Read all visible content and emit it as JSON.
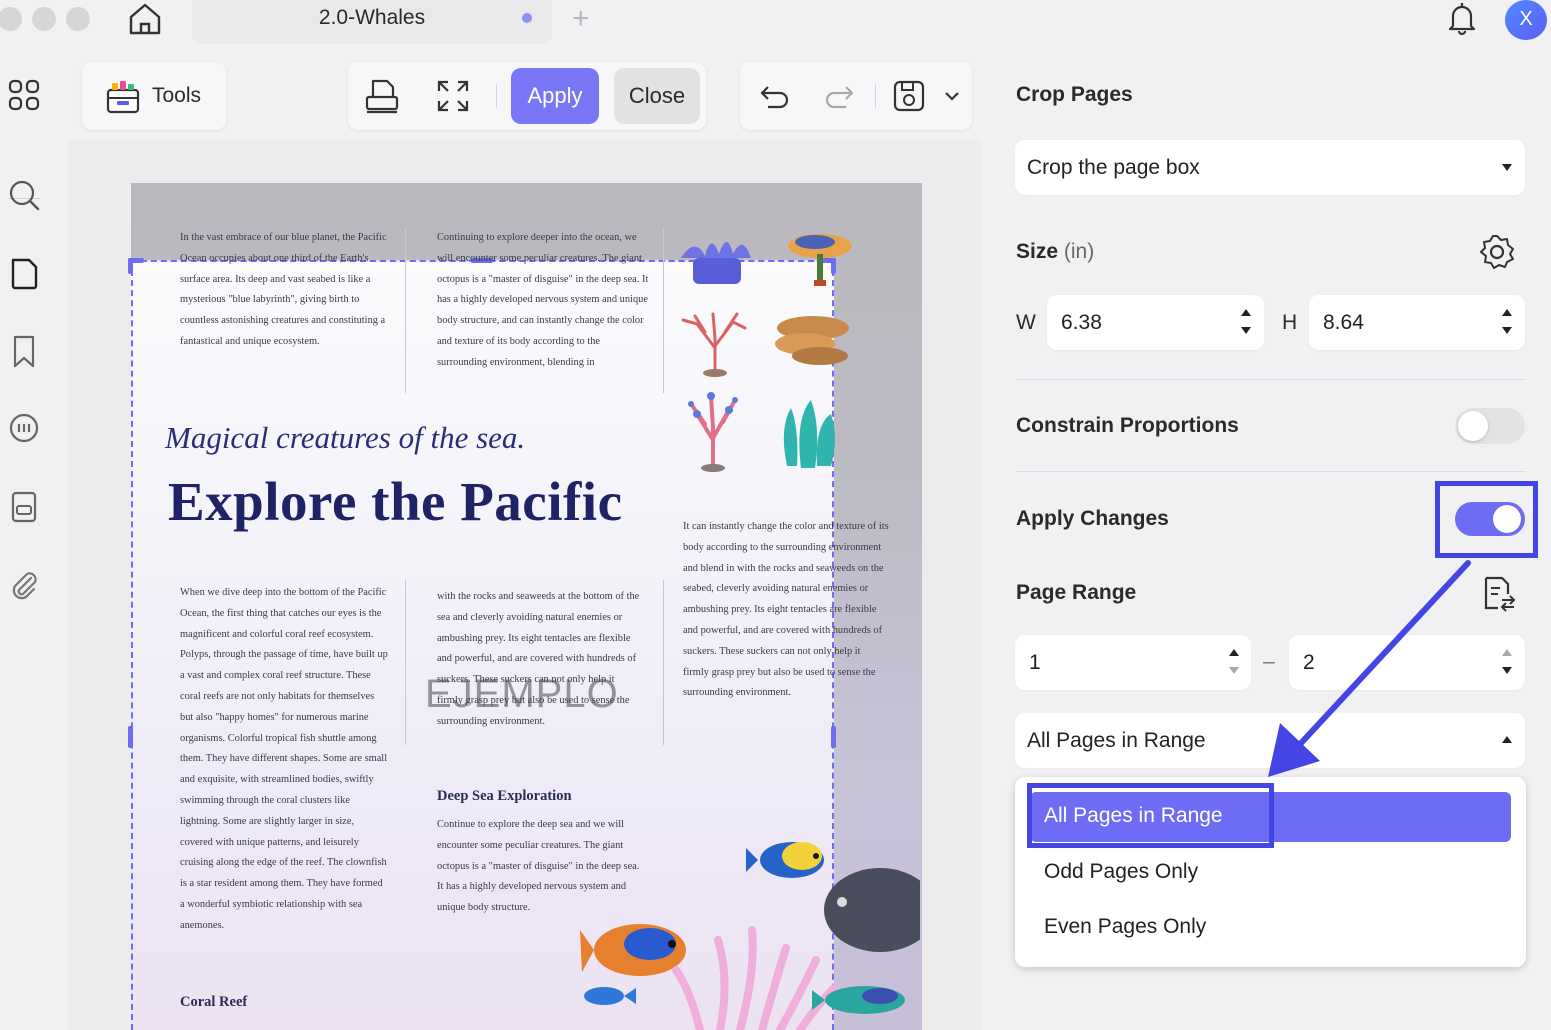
{
  "window": {
    "tab_title": "2.0-Whales",
    "avatar_letter": "X"
  },
  "toolbar": {
    "tools_label": "Tools",
    "apply_label": "Apply",
    "close_label": "Close"
  },
  "document": {
    "col1_top": "In the vast embrace of our blue planet, the Pacific Ocean occupies about one third of the Earth's surface area. Its deep and vast seabed is like a mysterious \"blue labyrinth\", giving birth to countless astonishing creatures and constituting a fantastical and unique ecosystem.",
    "col2_top": "Continuing to explore deeper into the ocean, we will encounter some peculiar creatures. The giant octopus is a \"master of disguise\" in the deep sea. It has a highly developed nervous system and unique body structure, and can instantly change the color and texture of its body according to the surrounding environment, blending in",
    "subtitle": "Magical creatures of the sea.",
    "title": "Explore the Pacific",
    "col3_right": "It can instantly change the color and texture of its body according to the surrounding environment and blend in with the rocks and seaweeds on the seabed, cleverly avoiding natural enemies or ambushing prey. Its eight tentacles are flexible and powerful, and are covered with hundreds of suckers. These suckers can not only help it firmly grasp prey but also be used to sense the surrounding environment.",
    "col1_bottom": "When we dive deep into the bottom of the Pacific Ocean, the first thing that catches our eyes is the magnificent and colorful coral reef ecosystem. Polyps, through the passage of time, have built up a vast and complex coral reef structure. These coral reefs are not only habitats for themselves but also \"happy homes\" for numerous marine organisms. Colorful tropical fish shuttle among them. They have different shapes. Some are small and exquisite, with streamlined bodies, swiftly swimming through the coral clusters like lightning. Some are slightly larger in size, covered with unique patterns, and leisurely cruising along the edge of the reef. The clownfish is a star resident among them. They have formed a wonderful symbiotic relationship with sea anemones.",
    "col2_mid": "with the rocks and seaweeds at the bottom of the sea and cleverly avoiding natural enemies or ambushing prey. Its eight tentacles are flexible and powerful, and are covered with hundreds of suckers. These suckers can not only help it firmly grasp prey but also be used to sense the surrounding environment.",
    "deep_sea_heading": "Deep Sea Exploration",
    "deep_sea_text": "Continue to explore the deep sea and we will encounter some peculiar creatures. The giant octopus is a \"master of disguise\" in the deep sea. It has a highly developed nervous system and unique body structure.",
    "coral_reef_heading": "Coral Reef",
    "watermark": "EJEMPLO"
  },
  "panel": {
    "title": "Crop Pages",
    "crop_mode": "Crop the page box",
    "size_label": "Size",
    "size_unit": "(in)",
    "w_label": "W",
    "w_value": "6.38",
    "h_label": "H",
    "h_value": "8.64",
    "constrain_label": "Constrain Proportions",
    "constrain_on": false,
    "apply_changes_label": "Apply Changes",
    "apply_changes_on": true,
    "page_range_label": "Page Range",
    "range_from": "1",
    "range_dash": "–",
    "range_to": "2",
    "range_mode": "All Pages in Range",
    "dropdown_options": [
      "All Pages in Range",
      "Odd Pages Only",
      "Even Pages Only"
    ],
    "selected_option": "All Pages in Range"
  },
  "colors": {
    "accent": "#6e6cf4",
    "highlight": "#4445e4",
    "title_navy": "#1f2366"
  }
}
